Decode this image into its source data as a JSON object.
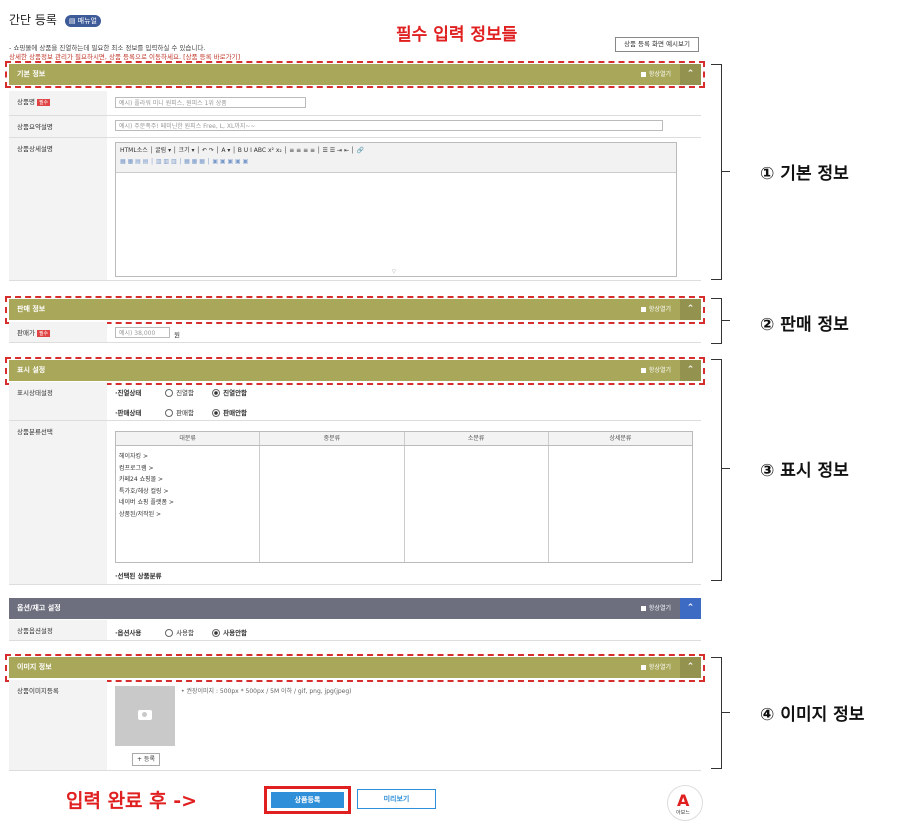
{
  "header": {
    "title": "간단 등록",
    "badge": "▤ 매뉴얼",
    "notice1": "- 쇼핑몰에 상품을 진열하는데 필요한 최소 정보를 입력하실 수 있습니다.",
    "notice2": "상세한 상품정보 관리가 필요하시면, 상품 등록으로 이동하세요. [상품 등록 바로가기]",
    "sample_button": "상품 등록 화면 예시보기"
  },
  "annotations": {
    "required_title": "필수 입력 정보들",
    "basic": "① 기본 정보",
    "sales": "② 판매 정보",
    "display": "③ 표시 정보",
    "image": "④ 이미지 정보",
    "after_input": "입력 완료 후 ->"
  },
  "toggle_label": "항상열기",
  "required_badge": "필수",
  "sections": {
    "basic": {
      "title": "기본 정보",
      "product_name_label": "상품명",
      "product_name_placeholder": "예시) 플라워 미니 원피스, 원피스 1위 상품",
      "summary_label": "상품요약설명",
      "summary_placeholder": "예시) 주문폭주! 페미닌한 원피스 Free, L, XL까지~~",
      "detail_label": "상품상세설명",
      "editor_tb1": "HTML소스 │ 굴림 ▾ │ 크기 ▾ │ ↶ ↷ │ A ▾ │ B U I ABC x² x₂ │ ≡ ≡ ≡ ≡ │ ☰ ☰ ⇥ ⇤ │ 🔗",
      "editor_tb2": "▦ ▦ ▤ ▤ │ ▥ ▥ ▥ │ ▦ ▦ ▦ │ ▣ ▣ ▣ ▣ ▣"
    },
    "sales": {
      "title": "판매 정보",
      "price_label": "판매가",
      "price_placeholder": "예시) 38,000",
      "price_unit": "원"
    },
    "display": {
      "title": "표시 설정",
      "setting_label": "표시상태설정",
      "display_state": "·진열상태",
      "display_yes": "진열함",
      "display_no": "진열안함",
      "sale_state": "·판매상태",
      "sale_yes": "판매함",
      "sale_no": "판매안함",
      "category_label": "상품분류선택",
      "col_large": "대분류",
      "col_mid": "중분류",
      "col_small": "소분류",
      "col_detail": "상세분류",
      "categories": [
        "헤이자킹 >",
        "컴프로그램 >",
        "카페24 쇼핑몰 >",
        "특가호/헤상 컬링 >",
        "네이버 쇼핑 플랫폼 >",
        "상품된/저작된 >"
      ],
      "selected_label": "·선택된 상품분류"
    },
    "option": {
      "title": "옵션/재고 설정",
      "option_label": "상품옵션설정",
      "option_use": "·옵션사용",
      "use_yes": "사용함",
      "use_no": "사용안함"
    },
    "image": {
      "title": "이미지 정보",
      "image_label": "상품이미지등록",
      "image_hint": "• 권장이미지 : 500px * 500px / 5M 이하 / gif, png, jpg(jpeg)",
      "add_button": "+ 등록"
    }
  },
  "footer": {
    "submit_button": "상품등록",
    "preview_button": "미리보기",
    "logo_text": "아보느"
  }
}
